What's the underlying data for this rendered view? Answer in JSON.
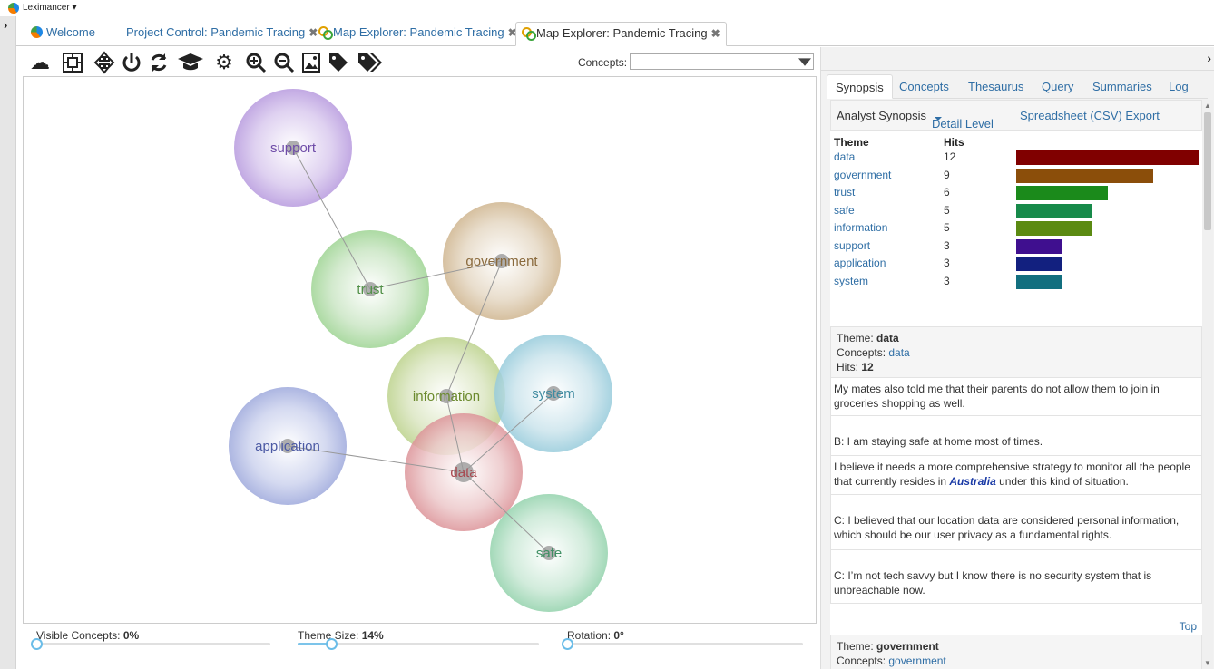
{
  "app": {
    "title": "Leximancer ▾"
  },
  "tabs": [
    {
      "label": "Welcome"
    },
    {
      "label": "Project Control: Pandemic Tracing"
    },
    {
      "label": "Map Explorer: Pandemic Tracing"
    },
    {
      "label": "Map Explorer: Pandemic Tracing"
    }
  ],
  "toolbar": {
    "icons": [
      "cloud-icon",
      "select-frame-icon",
      "move-icon",
      "power-icon",
      "refresh-icon",
      "graduation-cap-icon",
      "settings-icon",
      "zoom-in-icon",
      "zoom-out-icon",
      "export-image-icon",
      "tag-icon",
      "tags-icon"
    ],
    "concepts_label": "Concepts:",
    "concepts_value": ""
  },
  "map": {
    "themes": [
      {
        "label": "support",
        "color": "#a987d6"
      },
      {
        "label": "trust",
        "color": "#7cc472"
      },
      {
        "label": "government",
        "color": "#c6a679"
      },
      {
        "label": "information",
        "color": "#aac46a"
      },
      {
        "label": "system",
        "color": "#7cbcd0"
      },
      {
        "label": "application",
        "color": "#8391d0"
      },
      {
        "label": "data",
        "color": "#d77f85"
      },
      {
        "label": "safe",
        "color": "#7cc89a"
      }
    ]
  },
  "sliders": {
    "visible_concepts": {
      "label": "Visible Concepts:",
      "value": "0%",
      "fraction": 0
    },
    "theme_size": {
      "label": "Theme Size:",
      "value": "14%",
      "fraction": 0.14
    },
    "rotation": {
      "label": "Rotation:",
      "value": "0°",
      "fraction": 0
    }
  },
  "right": {
    "tabs": [
      "Synopsis",
      "Concepts",
      "Thesaurus",
      "Query",
      "Summaries",
      "Log"
    ],
    "header": {
      "title": "Analyst Synopsis",
      "detail_level": "Detail Level",
      "export": "Spreadsheet (CSV) Export"
    },
    "table": {
      "col_theme": "Theme",
      "col_hits": "Hits",
      "rows": [
        {
          "theme": "data",
          "hits": "12",
          "value": 12,
          "color": "#800000"
        },
        {
          "theme": "government",
          "hits": "9",
          "value": 9,
          "color": "#8b4e0a"
        },
        {
          "theme": "trust",
          "hits": "6",
          "value": 6,
          "color": "#1b8a1b"
        },
        {
          "theme": "safe",
          "hits": "5",
          "value": 5,
          "color": "#178a4a"
        },
        {
          "theme": "information",
          "hits": "5",
          "value": 5,
          "color": "#5b8a12"
        },
        {
          "theme": "support",
          "hits": "3",
          "value": 3,
          "color": "#3f0f8f"
        },
        {
          "theme": "application",
          "hits": "3",
          "value": 3,
          "color": "#12207f"
        },
        {
          "theme": "system",
          "hits": "3",
          "value": 3,
          "color": "#126f7f"
        }
      ]
    },
    "detail": {
      "theme_label": "Theme:",
      "theme": "data",
      "concepts_label": "Concepts:",
      "concepts": "data",
      "hits_label": "Hits:",
      "hits": "12",
      "quotes": [
        {
          "text": "My mates also told me that their parents do not allow them to join in groceries shopping as well."
        },
        {
          "text": "B: I am staying safe at home most of times."
        },
        {
          "pre": "I believe it needs a more comprehensive strategy to monitor all the people that currently resides in ",
          "em": "Australia",
          "post": " under this kind of situation."
        },
        {
          "text": "C: I believed that our location data are considered personal information, which should be our user privacy as a fundamental rights."
        },
        {
          "text": "C: I’m not tech savvy but I know there is no security system that is unbreachable now."
        }
      ],
      "top_link": "Top"
    },
    "next": {
      "theme_label": "Theme:",
      "theme": "government",
      "concepts_label": "Concepts:",
      "concepts": "government"
    }
  }
}
